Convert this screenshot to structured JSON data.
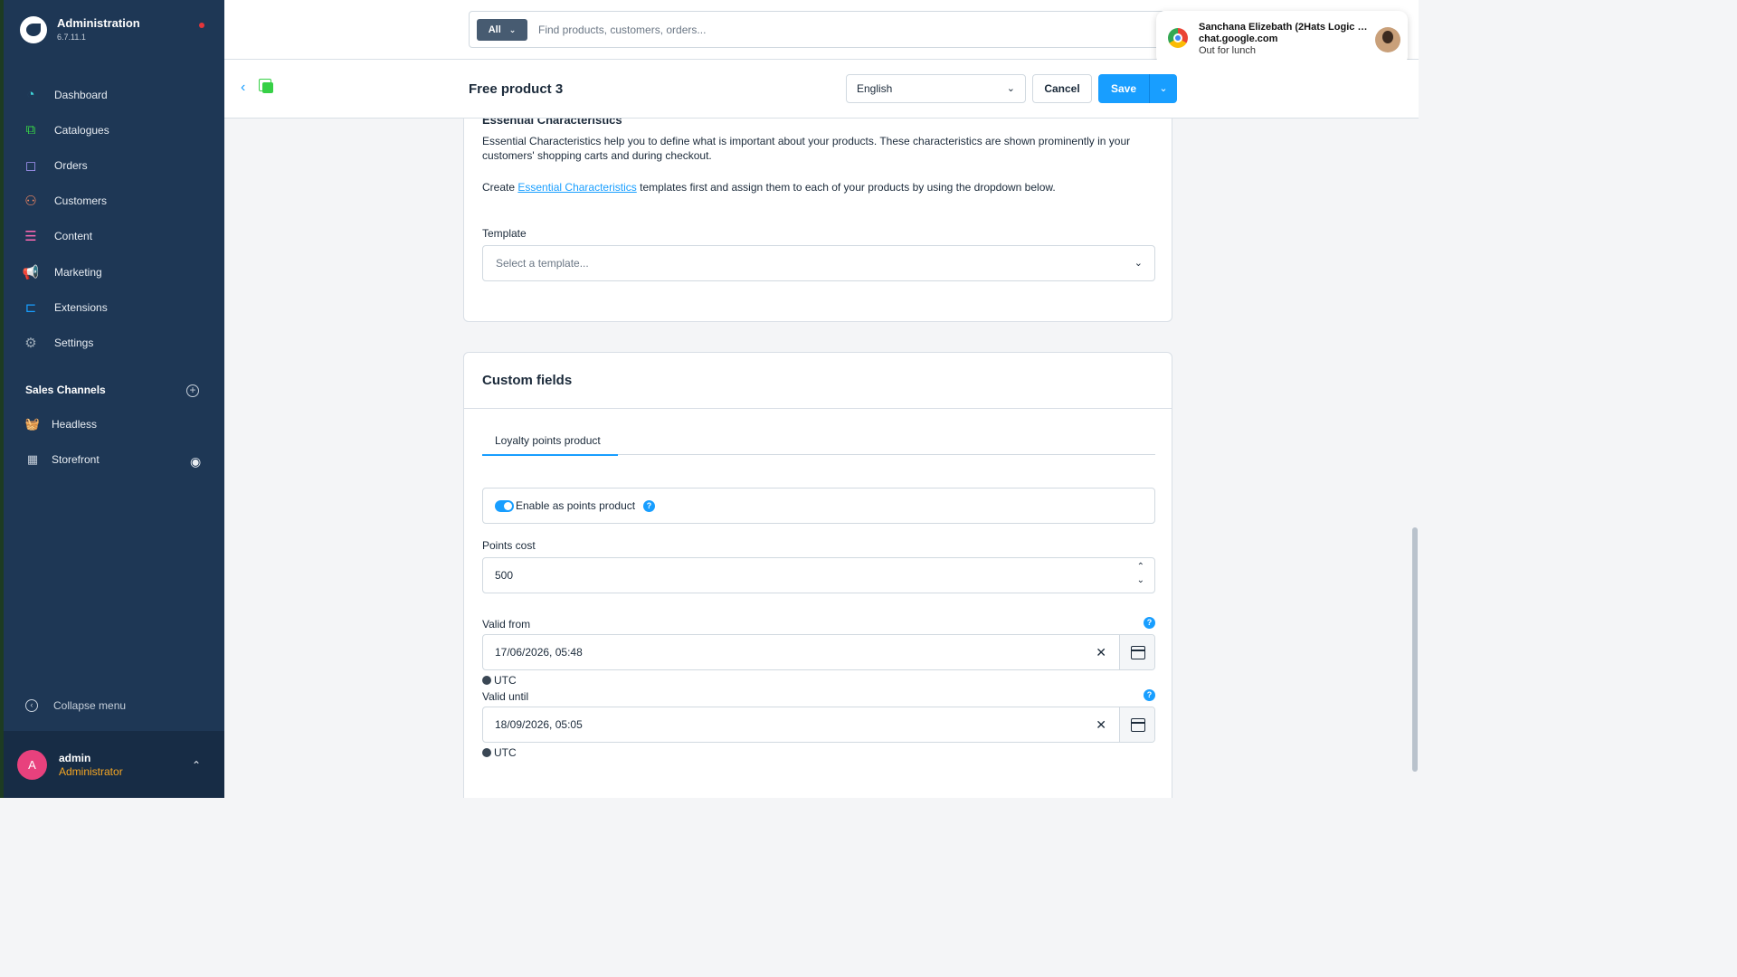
{
  "app": {
    "title": "Administration",
    "version": "6.7.11.1"
  },
  "sidebar": {
    "items": [
      {
        "label": "Dashboard",
        "icon": "dashboard-icon",
        "color": "#3fd3d8"
      },
      {
        "label": "Catalogues",
        "icon": "catalogue-icon",
        "color": "#37d046"
      },
      {
        "label": "Orders",
        "icon": "orders-icon",
        "color": "#a092f0"
      },
      {
        "label": "Customers",
        "icon": "customers-icon",
        "color": "#f88962"
      },
      {
        "label": "Content",
        "icon": "content-icon",
        "color": "#ff68b4"
      },
      {
        "label": "Marketing",
        "icon": "marketing-icon",
        "color": "#ffd700"
      },
      {
        "label": "Extensions",
        "icon": "extensions-icon",
        "color": "#189eff"
      },
      {
        "label": "Settings",
        "icon": "settings-icon",
        "color": "#9aa8b5"
      }
    ],
    "sales_channels_title": "Sales Channels",
    "sales_channels": [
      {
        "label": "Headless",
        "icon": "basket-icon"
      },
      {
        "label": "Storefront",
        "icon": "storefront-icon"
      }
    ],
    "collapse_label": "Collapse menu",
    "user": {
      "initial": "A",
      "name": "admin",
      "role": "Administrator"
    }
  },
  "search": {
    "scope": "All",
    "placeholder": "Find products, customers, orders..."
  },
  "notification": {
    "title": "Sanchana Elizebath (2Hats Logic T...",
    "source": "chat.google.com",
    "message": "Out for lunch"
  },
  "header": {
    "title": "Free product 3",
    "language": "English",
    "cancel_label": "Cancel",
    "save_label": "Save"
  },
  "essential": {
    "title": "Essential Characteristics",
    "description": "Essential Characteristics help you to define what is important about your products. These characteristics are shown prominently in your customers' shopping carts and during checkout.",
    "create_prefix": "Create",
    "create_link": "Essential Characteristics",
    "create_suffix": "templates first and assign them to each of your products by using the dropdown below.",
    "template_label": "Template",
    "template_placeholder": "Select a template..."
  },
  "custom_fields": {
    "title": "Custom fields",
    "tab": "Loyalty points product",
    "enable_label": "Enable as points product",
    "enable_value": true,
    "points_cost_label": "Points cost",
    "points_cost": "500",
    "valid_from_label": "Valid from",
    "valid_from": "17/06/2026, 05:48",
    "valid_until_label": "Valid until",
    "valid_until": "18/09/2026, 05:05",
    "timezone": "UTC"
  }
}
